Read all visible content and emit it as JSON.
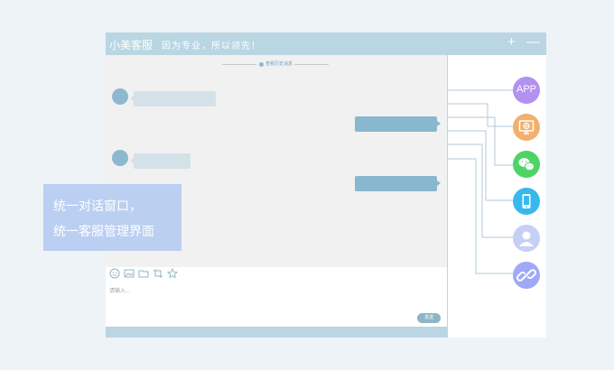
{
  "window": {
    "app_name": "小美客服",
    "slogan": "因为专业，所以领先！",
    "add_glyph": "+",
    "minimize_glyph": "—"
  },
  "chat": {
    "history_label": "查看历史消息",
    "input_placeholder": "请输入...",
    "send_label": "发送",
    "toolbar_icons": [
      "smile-icon",
      "image-icon",
      "folder-icon",
      "crop-icon",
      "star-icon"
    ]
  },
  "overlay": {
    "line1": "统一对话窗口，",
    "line2": "统一客服管理界面"
  },
  "channels": [
    {
      "name": "app-channel",
      "label": "APP",
      "color": "#b391f0"
    },
    {
      "name": "web-channel",
      "icon": "monitor-icon",
      "color": "#f2b06e"
    },
    {
      "name": "wechat-channel",
      "icon": "wechat-icon",
      "color": "#4dd464"
    },
    {
      "name": "mobile-channel",
      "icon": "mobile-icon",
      "color": "#38b8ec"
    },
    {
      "name": "user-channel",
      "icon": "user-icon",
      "color": "#c6cff5"
    },
    {
      "name": "link-channel",
      "icon": "link-icon",
      "color": "#9fa9f8"
    }
  ],
  "colors": {
    "titlebar": "#b9d6e2",
    "chat_background": "#f1f1f1",
    "bubble_agent": "#89b7ce",
    "bubble_user": "#d4e1e8",
    "overlay": "#afc7f0"
  }
}
